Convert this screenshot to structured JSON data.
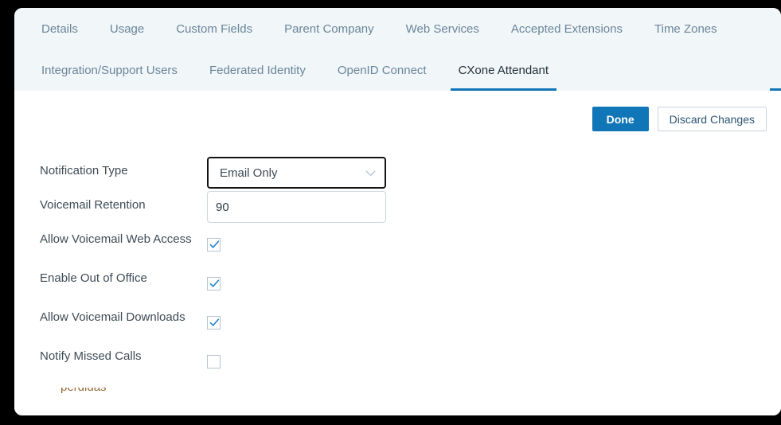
{
  "tabs": {
    "row1": [
      {
        "label": "Details",
        "active": false
      },
      {
        "label": "Usage",
        "active": false
      },
      {
        "label": "Custom Fields",
        "active": false
      },
      {
        "label": "Parent Company",
        "active": false
      },
      {
        "label": "Web Services",
        "active": false
      },
      {
        "label": "Accepted Extensions",
        "active": false
      },
      {
        "label": "Time Zones",
        "active": false
      }
    ],
    "row2": [
      {
        "label": "Integration/Support Users",
        "active": false
      },
      {
        "label": "Federated Identity",
        "active": false
      },
      {
        "label": "OpenID Connect",
        "active": false
      },
      {
        "label": "CXone Attendant",
        "active": true
      }
    ]
  },
  "toolbar": {
    "done_label": "Done",
    "discard_label": "Discard Changes"
  },
  "form": {
    "notification_type": {
      "label": "Notification Type",
      "value": "Email Only",
      "icon": "chevron-down-icon"
    },
    "voicemail_retention": {
      "label": "Voicemail Retention",
      "value": "90",
      "placeholder": ""
    },
    "allow_voicemail_web_access": {
      "label": "Allow Voicemail Web Access",
      "checked": true
    },
    "enable_out_of_office": {
      "label": "Enable Out of Office",
      "checked": true
    },
    "allow_voicemail_downloads": {
      "label": "Allow Voicemail Downloads",
      "checked": true
    },
    "notify_missed_calls": {
      "label": "Notify Missed Calls",
      "checked": false
    }
  },
  "overflow": {
    "clipped_text": "perdidas"
  },
  "colors": {
    "accent": "#1176b7",
    "tab_bar_bg": "#f1f6f9",
    "tab_inactive_text": "#6a8599",
    "tab_active_text": "#23313a",
    "label_text": "#3d4b55",
    "checkbox_border": "#b6c4cf",
    "input_border": "#ccd7df",
    "focused_border": "#141414"
  }
}
